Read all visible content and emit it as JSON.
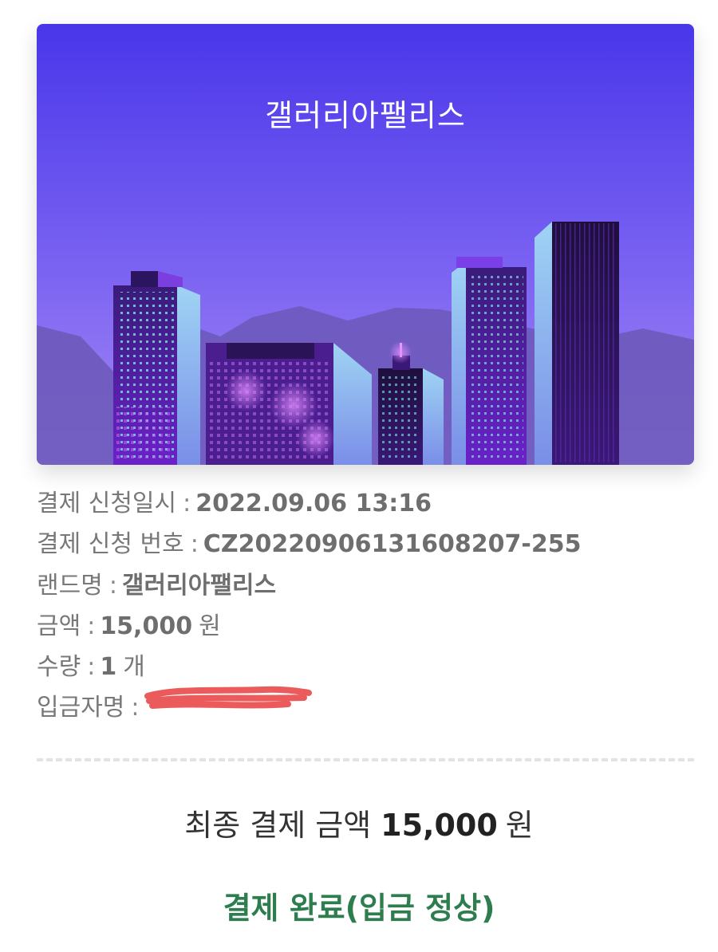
{
  "hero": {
    "title": "갤러리아팰리스"
  },
  "details": {
    "request_datetime": {
      "label": "결제 신청일시",
      "colon": ":",
      "value": "2022.09.06 13:16"
    },
    "request_number": {
      "label": "결제 신청 번호",
      "colon": ":",
      "value": "CZ20220906131608207-255"
    },
    "land_name": {
      "label": "랜드명",
      "colon": ":",
      "value": "갤러리아팰리스"
    },
    "amount": {
      "label": "금액",
      "colon": ":",
      "value": "15,000",
      "unit": "원"
    },
    "quantity": {
      "label": "수량",
      "colon": ":",
      "value": "1",
      "unit": "개"
    },
    "depositor": {
      "label": "입금자명",
      "colon": ":",
      "redacted": true
    }
  },
  "total": {
    "label": "최종 결제 금액",
    "value": "15,000",
    "unit": "원"
  },
  "status": {
    "text": "결제 완료(입금 정상)"
  },
  "colors": {
    "sky_top": "#4a37e8",
    "sky_bottom": "#a07ff0",
    "status_green": "#2e7d4f",
    "redaction_red": "#ec5b5b"
  }
}
